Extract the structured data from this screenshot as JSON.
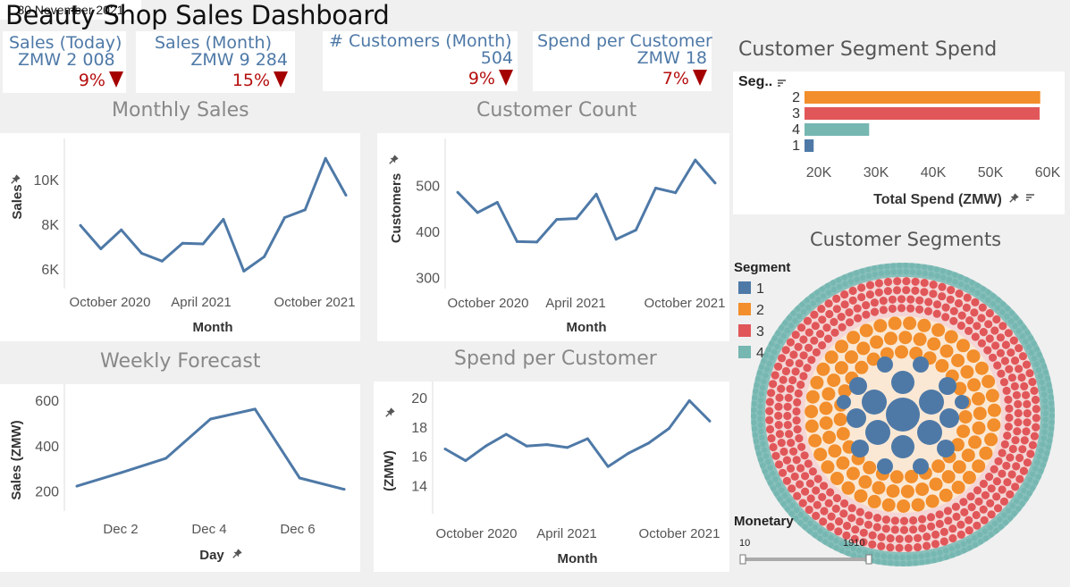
{
  "header": {
    "title": "Beauty Shop Sales Dashboard",
    "date": "30 November 2021"
  },
  "kpis": [
    {
      "label": "Sales (Today)",
      "value": "ZMW 2 008",
      "change": "9%"
    },
    {
      "label": "Sales (Month)",
      "value": "ZMW 9 284",
      "change": "15%"
    },
    {
      "label": "# Customers (Month)",
      "value": "504",
      "change": "9%"
    },
    {
      "label": "Spend per Customer",
      "value": "ZMW 18",
      "change": "7%"
    }
  ],
  "colors": {
    "line": "#4e79a7",
    "seg1": "#4e79a7",
    "seg2": "#f28e2b",
    "seg3": "#e15759",
    "seg4": "#76b7b2",
    "down": "#a50000"
  },
  "chart_data": [
    {
      "id": "monthly_sales",
      "type": "line",
      "title": "Monthly Sales",
      "xlabel": "Month",
      "ylabel": "Sales",
      "x_ticks": [
        "October 2020",
        "April 2021",
        "October 2021"
      ],
      "y_ticks": [
        "6K",
        "8K",
        "10K"
      ],
      "ylim": [
        5200,
        11600
      ],
      "values": [
        7950,
        6900,
        7750,
        6700,
        6350,
        7150,
        7120,
        8220,
        5900,
        6550,
        8300,
        8650,
        10950,
        9300
      ]
    },
    {
      "id": "customer_count",
      "type": "line",
      "title": "Customer Count",
      "xlabel": "Month",
      "ylabel": "Customers",
      "x_ticks": [
        "October 2020",
        "April 2021",
        "October 2021"
      ],
      "y_ticks": [
        "300",
        "400",
        "500"
      ],
      "ylim": [
        280,
        590
      ],
      "values": [
        485,
        441,
        463,
        378,
        377,
        426,
        428,
        481,
        383,
        403,
        494,
        484,
        555,
        505
      ]
    },
    {
      "id": "weekly_forecast",
      "type": "line",
      "title": "Weekly Forecast",
      "xlabel": "Day",
      "ylabel": "Sales (ZMW)",
      "x_ticks": [
        "Dec 2",
        "Dec 4",
        "Dec 6"
      ],
      "y_ticks": [
        "200",
        "400",
        "600"
      ],
      "ylim": [
        120,
        660
      ],
      "values": [
        222,
        282,
        345,
        518,
        562,
        258,
        208
      ]
    },
    {
      "id": "spend_per_customer",
      "type": "line",
      "title": "Spend per Customer",
      "xlabel": "Month",
      "ylabel": "(ZMW)",
      "x_ticks": [
        "October 2020",
        "April 2021",
        "October 2021"
      ],
      "y_ticks": [
        "14",
        "16",
        "18",
        "20"
      ],
      "ylim": [
        12.2,
        20.8
      ],
      "values": [
        16.5,
        15.7,
        16.7,
        17.5,
        16.7,
        16.8,
        16.6,
        17.2,
        15.3,
        16.2,
        16.9,
        17.9,
        19.8,
        18.4
      ]
    },
    {
      "id": "segment_spend",
      "type": "bar",
      "title": "Customer Segment Spend",
      "xlabel": "Total Spend (ZMW)",
      "ylabel": "Seg..",
      "categories": [
        "2",
        "3",
        "4",
        "1"
      ],
      "values": [
        58700,
        58600,
        28800,
        19100
      ],
      "x_ticks": [
        "20K",
        "30K",
        "40K",
        "50K",
        "60K"
      ],
      "xlim": [
        17500,
        62500
      ]
    },
    {
      "id": "customer_segments",
      "type": "other",
      "title": "Customer Segments",
      "legend_title": "Segment",
      "legend": [
        "1",
        "2",
        "3",
        "4"
      ]
    }
  ],
  "monetary_filter": {
    "label": "Monetary",
    "min": "10",
    "max": "1910"
  }
}
